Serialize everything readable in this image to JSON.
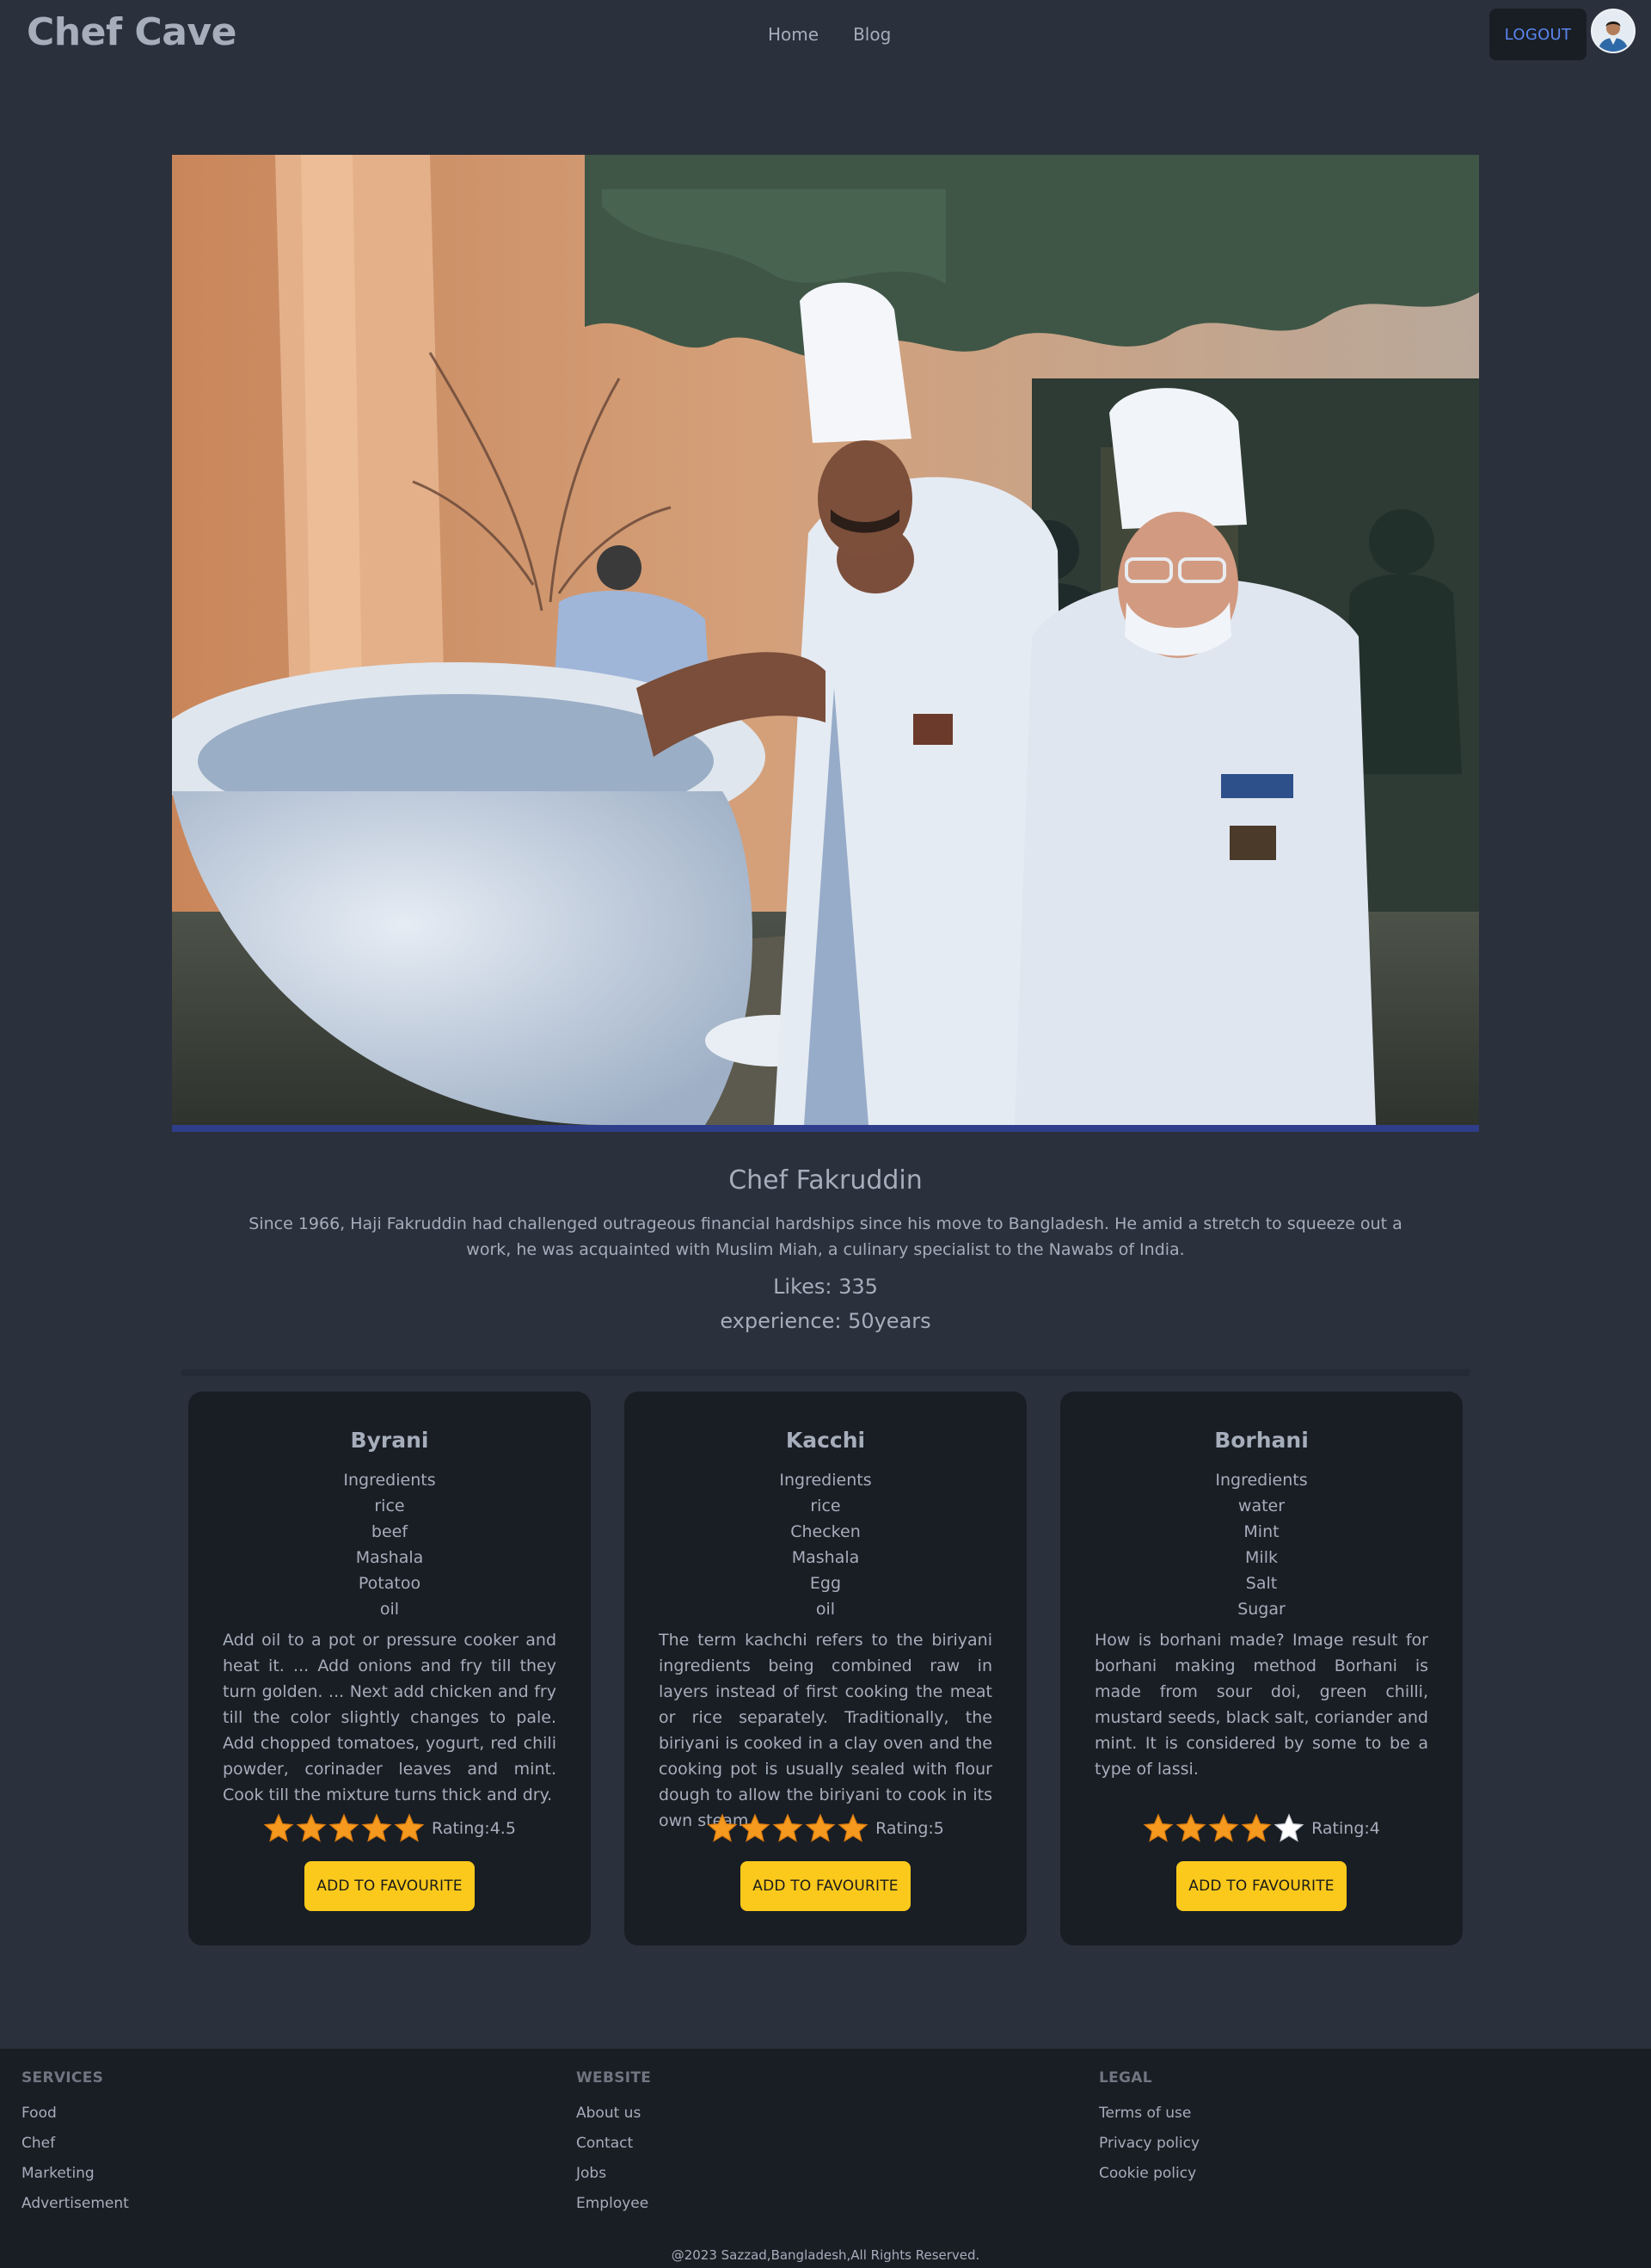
{
  "navbar": {
    "brand": "Chef Cave",
    "links": [
      "Home",
      "Blog"
    ],
    "logout_label": "LOGOUT"
  },
  "chef": {
    "name": "Chef Fakruddin",
    "bio": "Since 1966, Haji Fakruddin had challenged outrageous financial hardships since his move to Bangladesh. He amid a stretch to squeeze out a work, he was acquainted with Muslim Miah, a culinary specialist to the Nawabs of India.",
    "likes": "Likes: 335",
    "experience": "experience: 50years"
  },
  "recipes": [
    {
      "name": "Byrani",
      "ingredients_label": "Ingredients",
      "ingredients": [
        "rice",
        "beef",
        "Mashala",
        "Potatoo",
        "oil"
      ],
      "description": "Add oil to a pot or pressure cooker and heat it. ... Add onions and fry till they turn golden. ... Next add chicken and fry till the color slightly changes to pale. Add chopped tomatoes, yogurt, red chili powder, corinader leaves and mint. Cook till the mixture turns thick and dry.",
      "rating": 4.5,
      "rating_text": "Rating:4.5",
      "button": "ADD TO FAVOURITE"
    },
    {
      "name": "Kacchi",
      "ingredients_label": "Ingredients",
      "ingredients": [
        "rice",
        "Checken",
        "Mashala",
        "Egg",
        "oil"
      ],
      "description": "The term kachchi refers to the biriyani ingredients being combined raw in layers instead of first cooking the meat or rice separately. Traditionally, the biriyani is cooked in a clay oven and the cooking pot is usually sealed with flour dough to allow the biriyani to cook in its own steam.",
      "rating": 5,
      "rating_text": "Rating:5",
      "button": "ADD TO FAVOURITE"
    },
    {
      "name": "Borhani",
      "ingredients_label": "Ingredients",
      "ingredients": [
        "water",
        "Mint",
        "Milk",
        "Salt",
        "Sugar"
      ],
      "description": "How is borhani made? Image result for borhani making method Borhani is made from sour doi, green chilli, mustard seeds, black salt, coriander and mint. It is considered by some to be a type of lassi.",
      "rating": 4,
      "rating_text": "Rating:4",
      "button": "ADD TO FAVOURITE"
    }
  ],
  "footer": {
    "services": {
      "title": "SERVICES",
      "links": [
        "Food",
        "Chef",
        "Marketing",
        "Advertisement"
      ]
    },
    "website": {
      "title": "WEBSITE",
      "links": [
        "About us",
        "Contact",
        "Jobs",
        "Employee"
      ]
    },
    "legal": {
      "title": "LEGAL",
      "links": [
        "Terms of use",
        "Privacy policy",
        "Cookie policy"
      ]
    },
    "copyright": "@2023 Sazzad,Bangladesh,All Rights Reserved."
  },
  "colors": {
    "background": "#2a303c",
    "card": "#191e24",
    "accent_button": "#fbc91c",
    "logout_text": "#5a86f0",
    "star": "#f59a1e"
  },
  "icons": [
    "avatar-icon",
    "star-icon"
  ]
}
